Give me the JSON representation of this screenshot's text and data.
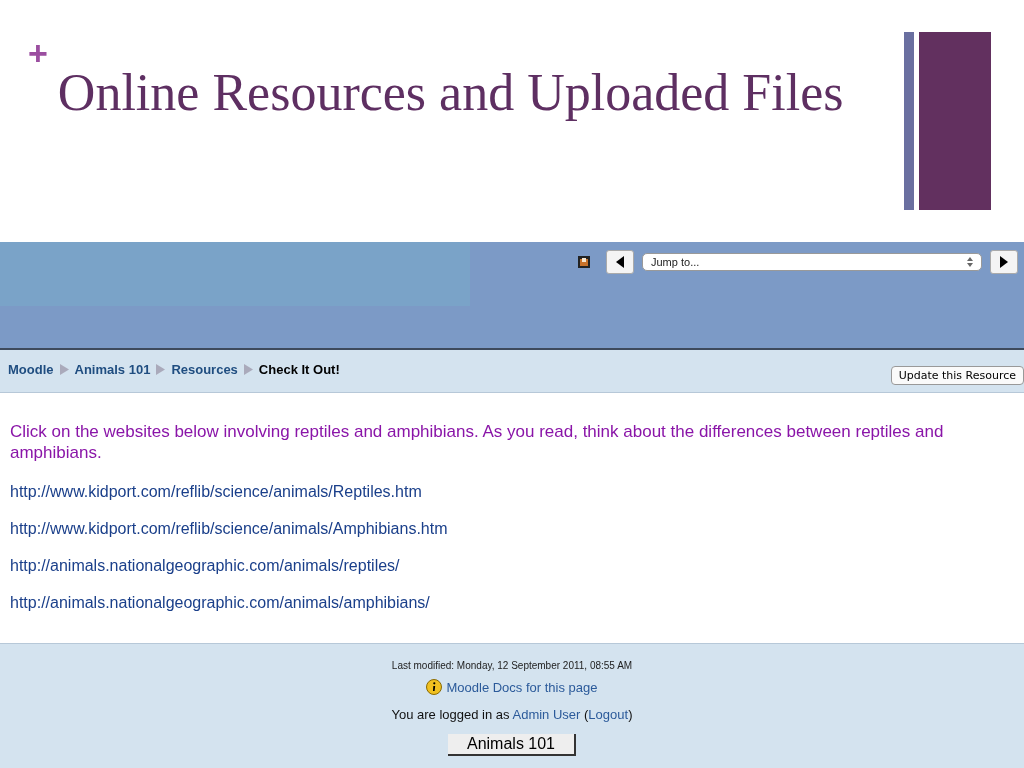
{
  "slide": {
    "title": "Online Resources and Uploaded Files",
    "plus": "+"
  },
  "navbar": {
    "jump": {
      "placeholder": "Jump to..."
    }
  },
  "breadcrumb": {
    "items": [
      {
        "label": "Moodle",
        "current": false
      },
      {
        "label": "Animals 101",
        "current": false
      },
      {
        "label": "Resources",
        "current": false
      },
      {
        "label": "Check It Out!",
        "current": true
      }
    ],
    "button": "Update this Resource"
  },
  "content": {
    "intro": "Click on the websites below involving reptiles and amphibians. As you read, think about the differences between reptiles and amphibians.",
    "links": [
      "http://www.kidport.com/reflib/science/animals/Reptiles.htm",
      "http://www.kidport.com/reflib/science/animals/Amphibians.htm",
      "http://animals.nationalgeographic.com/animals/reptiles/",
      "http://animals.nationalgeographic.com/animals/amphibians/"
    ]
  },
  "footer": {
    "modified": "Last modified: Monday, 12 September 2011, 08:55 AM",
    "docs": "Moodle Docs for this page",
    "login": {
      "before": "You are logged in as ",
      "user": "Admin User",
      "middle": " (",
      "logout": "Logout",
      "after": ")"
    },
    "course_button": "Animals 101"
  }
}
